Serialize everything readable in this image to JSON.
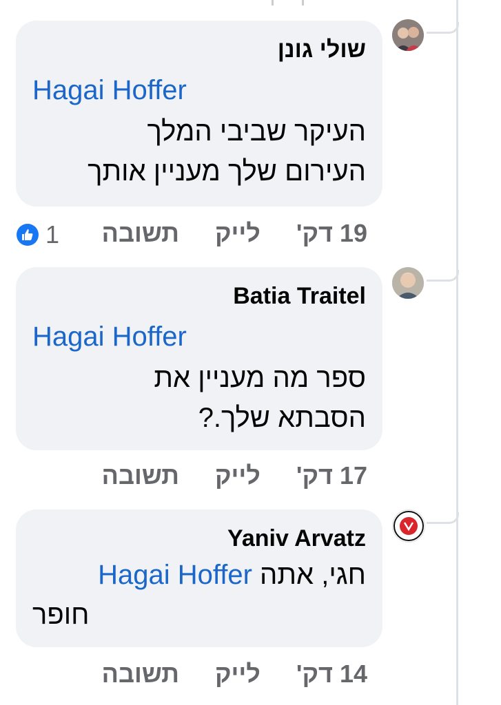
{
  "comments": [
    {
      "author": "שולי גונן",
      "mention": "Hagai Hoffer",
      "lines": [
        "העיקר שביבי המלך",
        "העירום שלך מעניין אותך"
      ],
      "time": "19 דק'",
      "like_label": "לייק",
      "reply_label": "תשובה",
      "reaction_count": "1"
    },
    {
      "author": "Batia Traitel",
      "mention": "Hagai Hoffer",
      "lines": [
        "ספר מה מעניין את",
        "הסבתא שלך.?"
      ],
      "time": "17 דק'",
      "like_label": "לייק",
      "reply_label": "תשובה"
    },
    {
      "author": "Yaniv Arvatz",
      "mention": "Hagai Hoffer",
      "inline_text": "חגי, אתה",
      "lines": [
        "חופר"
      ],
      "time": "14 דק'",
      "like_label": "לייק",
      "reply_label": "תשובה"
    }
  ],
  "colors": {
    "mention": "#1b66c9",
    "bubble": "#f0f2f5",
    "meta": "#65676b",
    "like_badge": "#1877f2"
  }
}
